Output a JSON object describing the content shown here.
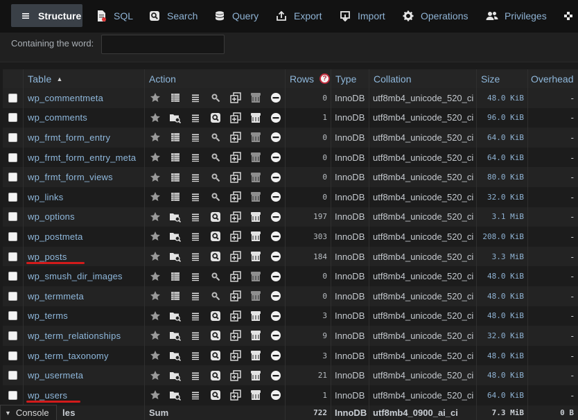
{
  "tabs": [
    {
      "label": "Structure",
      "icon": "structure-icon",
      "active": true
    },
    {
      "label": "SQL",
      "icon": "sql-icon"
    },
    {
      "label": "Search",
      "icon": "search-icon"
    },
    {
      "label": "Query",
      "icon": "query-icon"
    },
    {
      "label": "Export",
      "icon": "export-icon"
    },
    {
      "label": "Import",
      "icon": "import-icon"
    },
    {
      "label": "Operations",
      "icon": "operations-icon"
    },
    {
      "label": "Privileges",
      "icon": "privileges-icon"
    }
  ],
  "filter": {
    "label": "Containing the word:",
    "value": ""
  },
  "columns": {
    "table": "Table",
    "action": "Action",
    "rows": "Rows",
    "rows_help": "?",
    "type": "Type",
    "collation": "Collation",
    "size": "Size",
    "overhead": "Overhead"
  },
  "tables": [
    {
      "name": "wp_commentmeta",
      "rows": "0",
      "type": "InnoDB",
      "collation": "utf8mb4_unicode_520_ci",
      "size": "48.0 KiB",
      "overhead": "-",
      "empty": true
    },
    {
      "name": "wp_comments",
      "rows": "1",
      "type": "InnoDB",
      "collation": "utf8mb4_unicode_520_ci",
      "size": "96.0 KiB",
      "overhead": "-",
      "empty": false
    },
    {
      "name": "wp_frmt_form_entry",
      "rows": "0",
      "type": "InnoDB",
      "collation": "utf8mb4_unicode_520_ci",
      "size": "64.0 KiB",
      "overhead": "-",
      "empty": true
    },
    {
      "name": "wp_frmt_form_entry_meta",
      "rows": "0",
      "type": "InnoDB",
      "collation": "utf8mb4_unicode_520_ci",
      "size": "64.0 KiB",
      "overhead": "-",
      "empty": true
    },
    {
      "name": "wp_frmt_form_views",
      "rows": "0",
      "type": "InnoDB",
      "collation": "utf8mb4_unicode_520_ci",
      "size": "80.0 KiB",
      "overhead": "-",
      "empty": true
    },
    {
      "name": "wp_links",
      "rows": "0",
      "type": "InnoDB",
      "collation": "utf8mb4_unicode_520_ci",
      "size": "32.0 KiB",
      "overhead": "-",
      "empty": true
    },
    {
      "name": "wp_options",
      "rows": "197",
      "type": "InnoDB",
      "collation": "utf8mb4_unicode_520_ci",
      "size": "3.1 MiB",
      "overhead": "-",
      "empty": false
    },
    {
      "name": "wp_postmeta",
      "rows": "303",
      "type": "InnoDB",
      "collation": "utf8mb4_unicode_520_ci",
      "size": "208.0 KiB",
      "overhead": "-",
      "empty": false
    },
    {
      "name": "wp_posts",
      "rows": "184",
      "type": "InnoDB",
      "collation": "utf8mb4_unicode_520_ci",
      "size": "3.3 MiB",
      "overhead": "-",
      "empty": false,
      "underlined": true
    },
    {
      "name": "wp_smush_dir_images",
      "rows": "0",
      "type": "InnoDB",
      "collation": "utf8mb4_unicode_520_ci",
      "size": "48.0 KiB",
      "overhead": "-",
      "empty": true
    },
    {
      "name": "wp_termmeta",
      "rows": "0",
      "type": "InnoDB",
      "collation": "utf8mb4_unicode_520_ci",
      "size": "48.0 KiB",
      "overhead": "-",
      "empty": true
    },
    {
      "name": "wp_terms",
      "rows": "3",
      "type": "InnoDB",
      "collation": "utf8mb4_unicode_520_ci",
      "size": "48.0 KiB",
      "overhead": "-",
      "empty": false
    },
    {
      "name": "wp_term_relationships",
      "rows": "9",
      "type": "InnoDB",
      "collation": "utf8mb4_unicode_520_ci",
      "size": "32.0 KiB",
      "overhead": "-",
      "empty": false
    },
    {
      "name": "wp_term_taxonomy",
      "rows": "3",
      "type": "InnoDB",
      "collation": "utf8mb4_unicode_520_ci",
      "size": "48.0 KiB",
      "overhead": "-",
      "empty": false
    },
    {
      "name": "wp_usermeta",
      "rows": "21",
      "type": "InnoDB",
      "collation": "utf8mb4_unicode_520_ci",
      "size": "48.0 KiB",
      "overhead": "-",
      "empty": false
    },
    {
      "name": "wp_users",
      "rows": "1",
      "type": "InnoDB",
      "collation": "utf8mb4_unicode_520_ci",
      "size": "64.0 KiB",
      "overhead": "-",
      "empty": false,
      "underlined": true
    }
  ],
  "summary": {
    "label": "les",
    "action": "Sum",
    "rows": "722",
    "type": "InnoDB",
    "collation": "utf8mb4_0900_ai_ci",
    "size": "7.3 MiB",
    "overhead": "0 B"
  },
  "console": {
    "label": "Console"
  },
  "colors": {
    "link": "#8fb8dc",
    "underline": "#d21b1b",
    "tab_active_bg": "#3a4047"
  }
}
